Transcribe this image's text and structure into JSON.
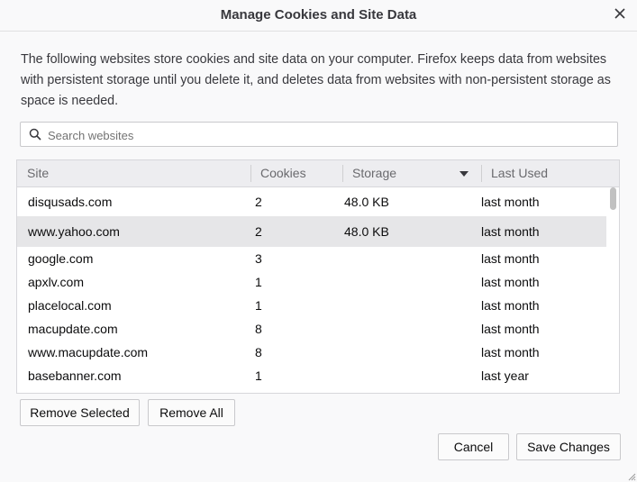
{
  "dialog": {
    "title": "Manage Cookies and Site Data",
    "close_icon": "close-icon",
    "description": "The following websites store cookies and site data on your computer. Firefox keeps data from websites with persistent storage until you delete it, and deletes data from websites with non-persistent storage as space is needed."
  },
  "search": {
    "placeholder": "Search websites",
    "value": "",
    "icon": "search-icon"
  },
  "table": {
    "columns": {
      "site": "Site",
      "cookies": "Cookies",
      "storage": "Storage",
      "last_used": "Last Used"
    },
    "sort_column": "Storage",
    "sort_direction": "descending",
    "rows": [
      {
        "site": "disqusads.com",
        "cookies": "2",
        "storage": "48.0 KB",
        "last_used": "last month",
        "selected": false
      },
      {
        "site": "www.yahoo.com",
        "cookies": "2",
        "storage": "48.0 KB",
        "last_used": "last month",
        "selected": true
      },
      {
        "site": "google.com",
        "cookies": "3",
        "storage": "",
        "last_used": "last month",
        "selected": false
      },
      {
        "site": "apxlv.com",
        "cookies": "1",
        "storage": "",
        "last_used": "last month",
        "selected": false
      },
      {
        "site": "placelocal.com",
        "cookies": "1",
        "storage": "",
        "last_used": "last month",
        "selected": false
      },
      {
        "site": "macupdate.com",
        "cookies": "8",
        "storage": "",
        "last_used": "last month",
        "selected": false
      },
      {
        "site": "www.macupdate.com",
        "cookies": "8",
        "storage": "",
        "last_used": "last month",
        "selected": false
      },
      {
        "site": "basebanner.com",
        "cookies": "1",
        "storage": "",
        "last_used": "last year",
        "selected": false
      }
    ]
  },
  "buttons": {
    "remove_selected": "Remove Selected",
    "remove_all": "Remove All",
    "cancel": "Cancel",
    "save_changes": "Save Changes"
  },
  "colors": {
    "selected_row": "#e6e6e8",
    "header_bg": "#ededf0",
    "dialog_bg": "#f9f9fa"
  }
}
